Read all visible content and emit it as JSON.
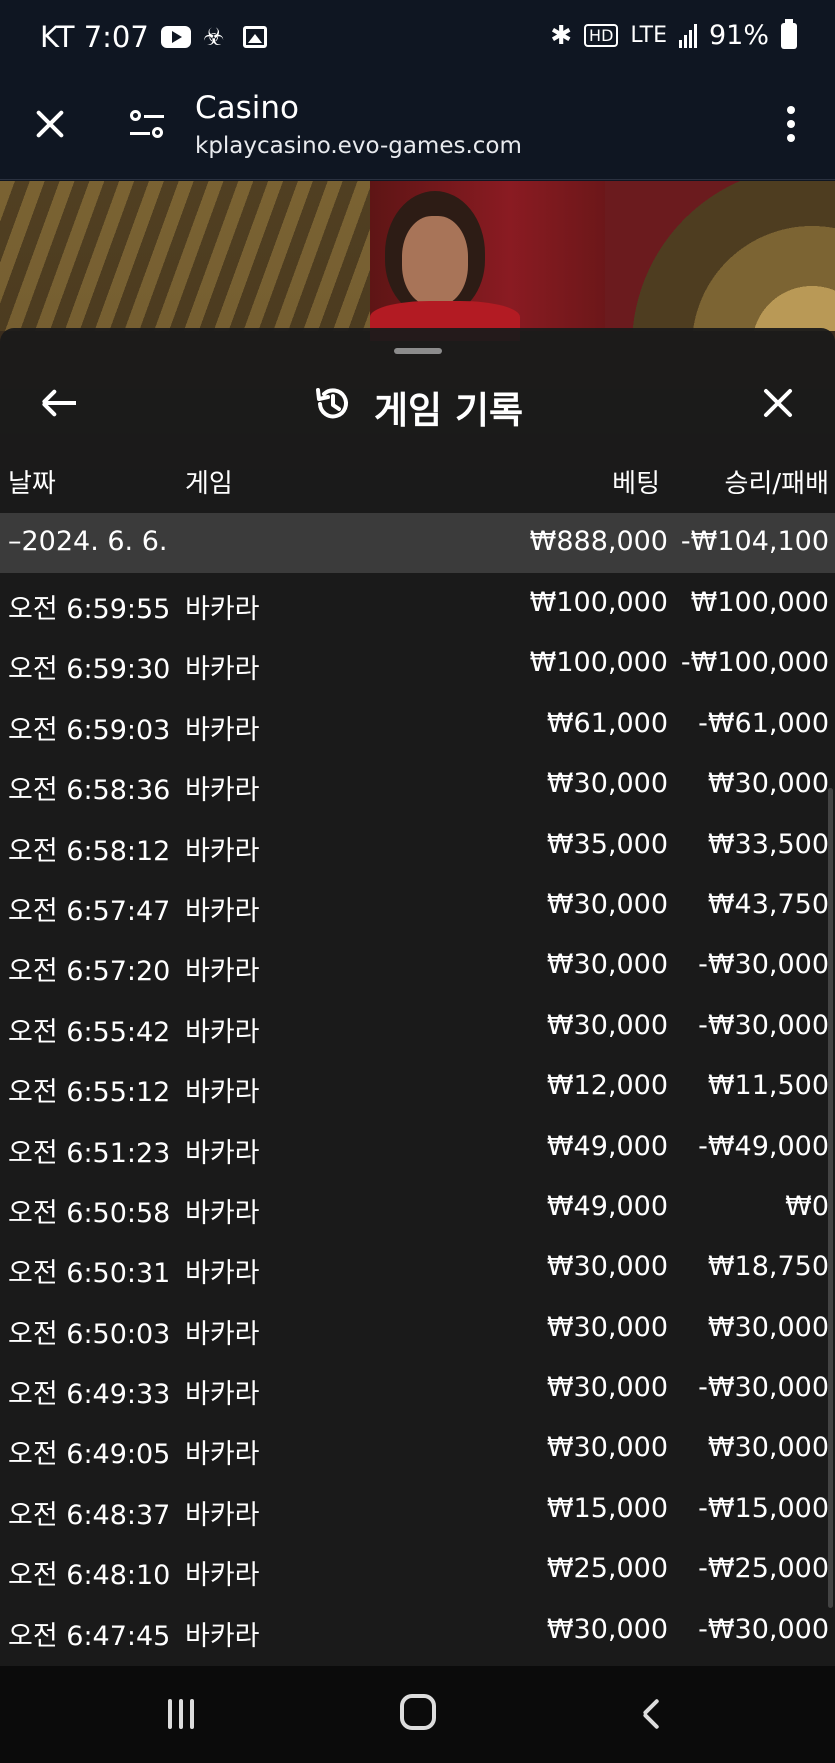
{
  "status_bar": {
    "carrier_time": "KT 7:07",
    "network": "LTE",
    "battery": "91%"
  },
  "browser": {
    "title": "Casino",
    "url": "kplaycasino.evo-games.com"
  },
  "history": {
    "title": "게임 기록",
    "columns": {
      "date": "날짜",
      "game": "게임",
      "bet": "베팅",
      "win_loss": "승리/패배"
    },
    "date_summary": {
      "date": "–2024. 6. 6.",
      "bet": "₩888,000",
      "win_loss": "-₩104,100"
    },
    "rows": [
      {
        "time": "오전 6:59:55",
        "game": "바카라",
        "bet": "₩100,000",
        "win_loss": "₩100,000"
      },
      {
        "time": "오전 6:59:30",
        "game": "바카라",
        "bet": "₩100,000",
        "win_loss": "-₩100,000"
      },
      {
        "time": "오전 6:59:03",
        "game": "바카라",
        "bet": "₩61,000",
        "win_loss": "-₩61,000"
      },
      {
        "time": "오전 6:58:36",
        "game": "바카라",
        "bet": "₩30,000",
        "win_loss": "₩30,000"
      },
      {
        "time": "오전 6:58:12",
        "game": "바카라",
        "bet": "₩35,000",
        "win_loss": "₩33,500"
      },
      {
        "time": "오전 6:57:47",
        "game": "바카라",
        "bet": "₩30,000",
        "win_loss": "₩43,750"
      },
      {
        "time": "오전 6:57:20",
        "game": "바카라",
        "bet": "₩30,000",
        "win_loss": "-₩30,000"
      },
      {
        "time": "오전 6:55:42",
        "game": "바카라",
        "bet": "₩30,000",
        "win_loss": "-₩30,000"
      },
      {
        "time": "오전 6:55:12",
        "game": "바카라",
        "bet": "₩12,000",
        "win_loss": "₩11,500"
      },
      {
        "time": "오전 6:51:23",
        "game": "바카라",
        "bet": "₩49,000",
        "win_loss": "-₩49,000"
      },
      {
        "time": "오전 6:50:58",
        "game": "바카라",
        "bet": "₩49,000",
        "win_loss": "₩0"
      },
      {
        "time": "오전 6:50:31",
        "game": "바카라",
        "bet": "₩30,000",
        "win_loss": "₩18,750"
      },
      {
        "time": "오전 6:50:03",
        "game": "바카라",
        "bet": "₩30,000",
        "win_loss": "₩30,000"
      },
      {
        "time": "오전 6:49:33",
        "game": "바카라",
        "bet": "₩30,000",
        "win_loss": "-₩30,000"
      },
      {
        "time": "오전 6:49:05",
        "game": "바카라",
        "bet": "₩30,000",
        "win_loss": "₩30,000"
      },
      {
        "time": "오전 6:48:37",
        "game": "바카라",
        "bet": "₩15,000",
        "win_loss": "-₩15,000"
      },
      {
        "time": "오전 6:48:10",
        "game": "바카라",
        "bet": "₩25,000",
        "win_loss": "-₩25,000"
      },
      {
        "time": "오전 6:47:45",
        "game": "바카라",
        "bet": "₩30,000",
        "win_loss": "-₩30,000"
      }
    ]
  },
  "colors": {
    "background": "#0f1622",
    "sheet": "#1b1b1b",
    "date_row": "#3b3b3b",
    "text": "#ffffff"
  }
}
